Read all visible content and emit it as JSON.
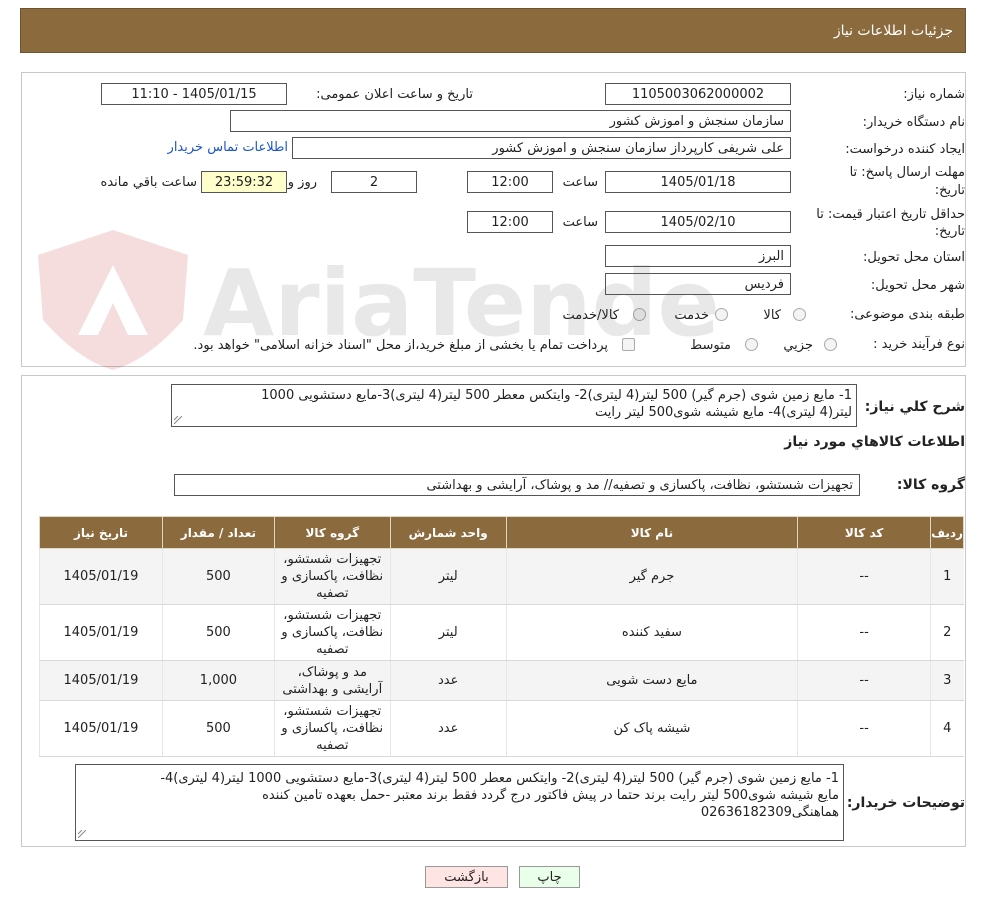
{
  "header": {
    "title": "جزئیات اطلاعات نیاز"
  },
  "form": {
    "need_number_label": "شماره نیاز:",
    "need_number": "1105003062000002",
    "announce_label": "تاریخ و ساعت اعلان عمومی:",
    "announce_value": "1405/01/15 - 11:10",
    "buyer_org_label": "نام دستگاه خریدار:",
    "buyer_org": "سازمان سنجش و اموزش کشور",
    "creator_label": "ایجاد کننده درخواست:",
    "creator": "علی  شریفی کارپرداز سازمان سنجش و اموزش کشور",
    "contact_link": "اطلاعات تماس خریدار",
    "deadline_label_1": "مهلت ارسال پاسخ: تا",
    "deadline_label_2": "تاریخ:",
    "deadline_date": "1405/01/18",
    "time_label": "ساعت",
    "deadline_time": "12:00",
    "days_value": "2",
    "days_label": "روز و",
    "remaining_value": "23:59:32",
    "remaining_label": "ساعت باقي مانده",
    "validity_label_1": "حداقل تاریخ اعتبار قیمت: تا",
    "validity_label_2": "تاریخ:",
    "validity_date": "1405/02/10",
    "validity_time": "12:00",
    "province_label": "استان محل تحویل:",
    "province": "البرز",
    "city_label": "شهر محل تحویل:",
    "city": "فردیس",
    "category_label": "طبقه بندی موضوعی:",
    "cat_goods": "کالا",
    "cat_service": "خدمت",
    "cat_both": "کالا/خدمت",
    "process_label": "نوع فرآیند خرید :",
    "proc_partial": "جزیي",
    "proc_medium": "متوسط",
    "payment_note": "پرداخت تمام یا بخشی از مبلغ خرید،از محل \"اسناد خزانه اسلامی\" خواهد بود."
  },
  "watermark": {
    "text": "AriaTender.neT"
  },
  "details": {
    "summary_label": "شرح کلي نياز:",
    "summary_line1": "1- مایع زمین شوی (جرم گیر) 500 لیتر(4 لیتری)2- وایتکس معطر 500 لیتر(4 لیتری)3-مایع دستشویی 1000",
    "summary_line2": "لیتر(4 لیتری)4- مایع شیشه شوی500 لیتر رایت",
    "goods_info_title": "اطلاعات کالاهاي مورد نياز",
    "group_label": "گروه کالا:",
    "group_value": "تجهیزات شستشو، نظافت، پاکسازی و تصفیه// مد و پوشاک، آرایشی و بهداشتی"
  },
  "table": {
    "headers": [
      "رديف",
      "کد کالا",
      "نام کالا",
      "واحد شمارش",
      "گروه کالا",
      "تعداد / مقدار",
      "تاریخ نیاز"
    ],
    "rows": [
      {
        "row": "1",
        "code": "--",
        "name": "جرم گیر",
        "unit": "لیتر",
        "group_lines": [
          "تجهیزات شستشو،",
          "نظافت، پاکسازی و",
          "تصفیه"
        ],
        "qty": "500",
        "date": "1405/01/19"
      },
      {
        "row": "2",
        "code": "--",
        "name": "سفید کننده",
        "unit": "لیتر",
        "group_lines": [
          "تجهیزات شستشو،",
          "نظافت، پاکسازی و",
          "تصفیه"
        ],
        "qty": "500",
        "date": "1405/01/19"
      },
      {
        "row": "3",
        "code": "--",
        "name": "مایع دست شویی",
        "unit": "عدد",
        "group_lines": [
          "مد و پوشاک،",
          "آرایشی و بهداشتی"
        ],
        "qty": "1,000",
        "date": "1405/01/19"
      },
      {
        "row": "4",
        "code": "--",
        "name": "شیشه پاک کن",
        "unit": "عدد",
        "group_lines": [
          "تجهیزات شستشو،",
          "نظافت، پاکسازی و",
          "تصفیه"
        ],
        "qty": "500",
        "date": "1405/01/19"
      }
    ]
  },
  "buyer_notes": {
    "label": "توضیحات خریدار:",
    "line1": "1- مایع زمین شوی (جرم گیر) 500 لیتر(4 لیتری)2- وایتکس معطر 500 لیتر(4 لیتری)3-مایع دستشویی 1000 لیتر(4 لیتری)4-",
    "line2": "مایع شیشه شوی500 لیتر رایت برند حتما در پیش فاکتور درج گردد فقط برند معتبر -حمل بعهده تامین کننده",
    "line3": "هماهنگی02636182309"
  },
  "buttons": {
    "print": "چاپ",
    "back": "بازگشت"
  },
  "colors": {
    "header_bg": "#8b6a3e",
    "link": "#1d56c9",
    "print_bg": "#eaffea",
    "back_bg": "#ffe4e4",
    "remaining_bg": "#ffffcc"
  }
}
